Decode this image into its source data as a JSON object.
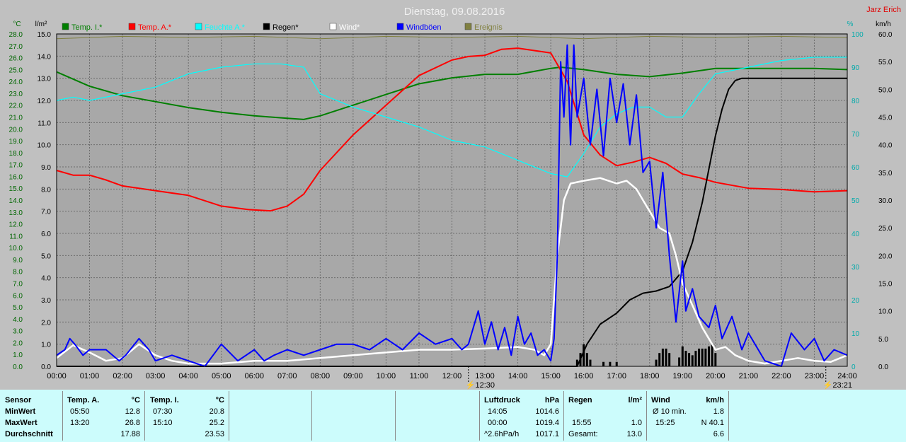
{
  "chart_data": {
    "type": "line",
    "title": "Dienstag, 09.08.2016",
    "author": "Jarz Erich",
    "left_axis_units": [
      "°C",
      "l/m²"
    ],
    "right_axis_units": [
      "%",
      "km/h"
    ],
    "legend": [
      {
        "name": "Temp. I.*",
        "color": "#007f00"
      },
      {
        "name": "Temp. A.*",
        "color": "#ff0000"
      },
      {
        "name": "Feuchte A.*",
        "color": "#00ffff"
      },
      {
        "name": "Regen*",
        "color": "#000000"
      },
      {
        "name": "Wind*",
        "color": "#ffffff"
      },
      {
        "name": "Windböen",
        "color": "#0000ff"
      },
      {
        "name": "Ereignis",
        "color": "#808040"
      }
    ],
    "x_ticks": [
      "00:00",
      "01:00",
      "02:00",
      "03:00",
      "04:00",
      "05:00",
      "06:00",
      "07:00",
      "08:00",
      "09:00",
      "10:00",
      "11:00",
      "12:00",
      "13:00",
      "14:00",
      "15:00",
      "16:00",
      "17:00",
      "18:00",
      "19:00",
      "20:00",
      "21:00",
      "22:00",
      "23:00",
      "24:00"
    ],
    "temp_axis": {
      "ylim": [
        0,
        28
      ],
      "ticks": [
        "0.0",
        "1.0",
        "2.0",
        "3.0",
        "4.0",
        "5.0",
        "6.0",
        "7.0",
        "8.0",
        "9.0",
        "10.0",
        "11.0",
        "12.0",
        "13.0",
        "14.0",
        "15.0",
        "16.0",
        "17.0",
        "18.0",
        "19.0",
        "20.0",
        "21.0",
        "22.0",
        "23.0",
        "24.0",
        "25.0",
        "26.0",
        "27.0",
        "28.0"
      ]
    },
    "rain_axis": {
      "ylim": [
        0,
        15
      ],
      "ticks": [
        "0.0",
        "1.0",
        "2.0",
        "3.0",
        "4.0",
        "5.0",
        "6.0",
        "7.0",
        "8.0",
        "9.0",
        "10.0",
        "11.0",
        "12.0",
        "13.0",
        "14.0",
        "15.0"
      ]
    },
    "humidity_axis": {
      "ylim": [
        0,
        100
      ],
      "ticks": [
        "0",
        "10",
        "20",
        "30",
        "40",
        "50",
        "60",
        "70",
        "80",
        "90",
        "100"
      ]
    },
    "wind_axis": {
      "ylim": [
        0,
        60
      ],
      "ticks": [
        "0.0",
        "5.0",
        "10.0",
        "15.0",
        "20.0",
        "25.0",
        "30.0",
        "35.0",
        "40.0",
        "45.0",
        "50.0",
        "55.0",
        "60.0"
      ]
    },
    "event_markers": [
      {
        "label": "12:30",
        "x": 12.5
      },
      {
        "label": "23:21",
        "x": 23.35
      }
    ],
    "series": [
      {
        "name": "Temp. I.*",
        "axis": "temp",
        "color": "#007f00",
        "x": [
          0,
          1,
          2,
          3,
          4,
          5,
          6,
          7,
          7.5,
          8,
          9,
          10,
          11,
          12,
          13,
          14,
          15,
          15.3,
          16,
          17,
          18,
          19,
          20,
          21,
          22,
          23,
          24
        ],
        "y": [
          24.8,
          23.6,
          22.8,
          22.3,
          21.8,
          21.4,
          21.1,
          20.9,
          20.8,
          21.1,
          22.0,
          22.9,
          23.8,
          24.3,
          24.6,
          24.6,
          25.1,
          25.2,
          25.0,
          24.6,
          24.4,
          24.7,
          25.1,
          25.1,
          25.1,
          25.1,
          25.0
        ]
      },
      {
        "name": "Temp. A.*",
        "axis": "temp",
        "color": "#ff0000",
        "x": [
          0,
          0.5,
          1,
          1.5,
          2,
          3,
          4,
          5,
          5.83,
          6.5,
          7,
          7.5,
          8,
          9,
          10,
          11,
          12,
          12.5,
          13,
          13.5,
          14,
          14.5,
          15,
          15.5,
          16,
          16.5,
          17,
          17.5,
          18,
          18.5,
          19,
          19.5,
          20,
          21,
          22,
          23,
          24
        ],
        "y": [
          16.5,
          16.1,
          16.1,
          15.7,
          15.2,
          14.8,
          14.4,
          13.5,
          13.2,
          13.1,
          13.5,
          14.5,
          16.5,
          19.5,
          22,
          24.5,
          25.8,
          26.1,
          26.2,
          26.7,
          26.8,
          26.6,
          26.4,
          24,
          19.5,
          17.8,
          16.9,
          17.2,
          17.6,
          17.1,
          16.2,
          15.9,
          15.5,
          15.0,
          14.9,
          14.7,
          14.8
        ]
      },
      {
        "name": "Feuchte A.*",
        "axis": "humidity",
        "color": "#00ffff",
        "x": [
          0,
          0.5,
          1,
          2,
          3,
          4,
          5,
          6,
          6.8,
          7.5,
          8,
          9,
          10,
          11,
          12,
          13,
          14,
          15,
          15.5,
          16,
          16.5,
          17,
          17.5,
          18,
          18.5,
          19,
          19.5,
          20,
          21,
          22,
          23,
          24
        ],
        "y": [
          80,
          81,
          80,
          82,
          84,
          88,
          90,
          91,
          91,
          90,
          82,
          78,
          75,
          72,
          68,
          66,
          62,
          58,
          57,
          64,
          72,
          76,
          78,
          78,
          75,
          75,
          82,
          88,
          90,
          92,
          93,
          93
        ]
      },
      {
        "name": "Regen*",
        "axis": "rain",
        "color": "#000000",
        "x": [
          0,
          15.8,
          16.1,
          16.5,
          17,
          17.4,
          17.8,
          18.2,
          18.6,
          19,
          19.3,
          19.6,
          19.8,
          20,
          20.2,
          20.4,
          20.6,
          20.8,
          21,
          24
        ],
        "y": [
          0,
          0,
          1.0,
          1.9,
          2.4,
          3.0,
          3.3,
          3.4,
          3.6,
          4.3,
          5.6,
          7.4,
          8.9,
          10.4,
          11.6,
          12.5,
          12.9,
          13.0,
          13.0,
          13.0
        ]
      },
      {
        "name": "Wind*",
        "axis": "wind",
        "color": "#ffffff",
        "x": [
          0,
          0.5,
          1,
          1.5,
          2,
          2.5,
          3,
          3.5,
          4,
          5,
          6,
          7,
          8,
          9,
          10,
          11,
          12,
          13,
          14,
          14.5,
          14.8,
          15,
          15.2,
          15.4,
          15.6,
          16,
          16.5,
          17,
          17.3,
          17.6,
          17.8,
          18,
          18.3,
          18.6,
          18.8,
          19,
          19.3,
          19.6,
          19.8,
          20,
          20.3,
          20.6,
          21,
          21.5,
          22,
          22.5,
          23,
          23.5,
          24
        ],
        "y": [
          1.5,
          3.8,
          2.5,
          1.0,
          1.5,
          4.0,
          2.0,
          1.0,
          0.5,
          0.5,
          1.0,
          1.0,
          1.5,
          2.0,
          2.5,
          3.0,
          3.0,
          3.2,
          3.5,
          3.0,
          2.0,
          4.0,
          20.0,
          30.0,
          33.0,
          33.5,
          34.0,
          33.0,
          33.5,
          32.0,
          30.0,
          28.0,
          25.0,
          24.0,
          20.0,
          15.0,
          11.0,
          7.0,
          5.0,
          3.0,
          3.5,
          2.0,
          1.0,
          0.5,
          1.0,
          1.5,
          1.0,
          0.8,
          2.0
        ]
      },
      {
        "name": "Windböen",
        "axis": "wind",
        "color": "#0000ff",
        "x": [
          0,
          0.25,
          0.4,
          0.55,
          0.8,
          1,
          1.5,
          1.9,
          2.1,
          2.5,
          2.8,
          3,
          3.5,
          4,
          4.5,
          5,
          5.5,
          6,
          6.3,
          6.6,
          7,
          7.5,
          8,
          8.5,
          9,
          9.5,
          10,
          10.5,
          11,
          11.5,
          12,
          12.3,
          12.5,
          12.8,
          13,
          13.2,
          13.4,
          13.6,
          13.8,
          14,
          14.2,
          14.4,
          14.6,
          14.8,
          15,
          15.1,
          15.2,
          15.3,
          15.4,
          15.5,
          15.6,
          15.7,
          15.8,
          16,
          16.2,
          16.4,
          16.6,
          16.8,
          17,
          17.2,
          17.4,
          17.6,
          17.8,
          18,
          18.2,
          18.4,
          18.6,
          18.8,
          19,
          19.1,
          19.3,
          19.5,
          19.8,
          20,
          20.2,
          20.5,
          20.8,
          21,
          21.5,
          22,
          22.3,
          22.7,
          23,
          23.3,
          23.6,
          24
        ],
        "y": [
          2,
          3,
          5,
          4,
          2,
          3,
          3,
          1,
          2,
          5,
          3,
          1,
          2,
          1,
          0,
          4,
          1,
          3,
          1,
          2,
          3,
          2,
          3,
          4,
          4,
          3,
          5,
          3,
          6,
          4,
          5,
          3,
          4,
          10,
          4,
          8,
          3,
          7,
          2,
          9,
          4,
          6,
          2,
          3,
          1,
          5,
          20,
          55,
          45,
          58,
          40,
          58,
          45,
          52,
          40,
          50,
          38,
          52,
          44,
          51,
          40,
          49,
          35,
          37,
          25,
          35,
          20,
          8,
          19,
          10,
          14,
          9,
          7,
          11,
          5,
          9,
          3,
          6,
          1,
          0,
          6,
          3,
          5,
          1,
          3,
          2
        ]
      },
      {
        "name": "Ereignis",
        "axis": "temp",
        "color": "#808040",
        "x": [
          0,
          2,
          4,
          6,
          8,
          10,
          12,
          14,
          16,
          18,
          20,
          22,
          24
        ],
        "y": [
          27.6,
          27.8,
          27.7,
          27.8,
          27.6,
          27.8,
          27.7,
          27.8,
          27.6,
          27.8,
          27.7,
          27.8,
          27.7
        ]
      }
    ],
    "rain_bars": {
      "x": [
        15.8,
        15.9,
        16.0,
        16.1,
        16.2,
        16.6,
        16.8,
        17.0,
        18.2,
        18.3,
        18.4,
        18.5,
        18.6,
        18.9,
        19.0,
        19.1,
        19.2,
        19.3,
        19.4,
        19.5,
        19.6,
        19.7,
        19.8,
        19.9,
        20.0
      ],
      "y": [
        0.3,
        0.6,
        1.0,
        0.6,
        0.3,
        0.2,
        0.2,
        0.2,
        0.3,
        0.6,
        0.8,
        0.8,
        0.6,
        0.4,
        0.9,
        0.7,
        0.6,
        0.5,
        0.7,
        0.8,
        0.8,
        0.8,
        0.9,
        1.0,
        0.6
      ]
    }
  },
  "stats": {
    "sensor": {
      "title": "Sensor",
      "min": "MinWert",
      "max": "MaxWert",
      "avg": "Durchschnitt"
    },
    "temp_a": {
      "title": "Temp. A.",
      "unit": "°C",
      "min_time": "05:50",
      "min_val": "12.8",
      "max_time": "13:20",
      "max_val": "26.8",
      "avg": "17.88"
    },
    "temp_i": {
      "title": "Temp. I.",
      "unit": "°C",
      "min_time": "07:30",
      "min_val": "20.8",
      "max_time": "15:10",
      "max_val": "25.2",
      "avg": "23.53"
    },
    "pressure": {
      "title": "Luftdruck",
      "unit": "hPa",
      "min_time": "14:05",
      "min_val": "1014.6",
      "max_time": "00:00",
      "max_val": "1019.4",
      "trend": "^2.6hPa/h",
      "avg": "1017.1"
    },
    "rain": {
      "title": "Regen",
      "unit": "l/m²",
      "max_time": "15:55",
      "max_val": "1.0",
      "total_label": "Gesamt:",
      "total": "13.0"
    },
    "wind": {
      "title": "Wind",
      "unit": "km/h",
      "avg10_label": "Ø 10 min.",
      "avg10": "1.8",
      "max_time": "15:25",
      "max_val": "N 40.1",
      "avg": "6.6"
    }
  }
}
